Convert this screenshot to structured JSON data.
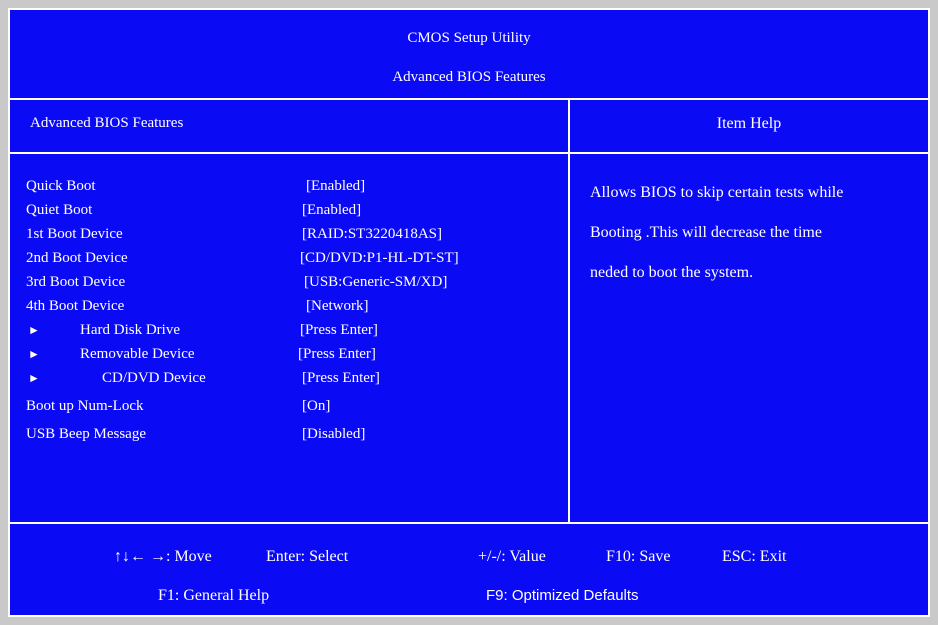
{
  "header": {
    "title": "CMOS Setup Utility",
    "subtitle": "Advanced BIOS Features"
  },
  "section": {
    "left_label": "Advanced BIOS Features",
    "right_label": "Item Help"
  },
  "settings": [
    {
      "label": "Quick Boot",
      "value": "[Enabled]",
      "submenu": false
    },
    {
      "label": "Quiet Boot",
      "value": "[Enabled]",
      "submenu": false
    },
    {
      "label": "1st Boot Device",
      "value": "[RAID:ST3220418AS]",
      "submenu": false
    },
    {
      "label": "2nd Boot Device",
      "value": "[CD/DVD:P1-HL-DT-ST]",
      "submenu": false
    },
    {
      "label": "3rd Boot Device",
      "value": "[USB:Generic-SM/XD]",
      "submenu": false
    },
    {
      "label": "4th Boot Device",
      "value": "[Network]",
      "submenu": false
    },
    {
      "label": "Hard Disk Drive",
      "value": "[Press Enter]",
      "submenu": true
    },
    {
      "label": "Removable Device",
      "value": "[Press Enter]",
      "submenu": true
    },
    {
      "label": "CD/DVD Device",
      "value": "[Press Enter]",
      "submenu": true
    },
    {
      "label": "Boot up Num-Lock",
      "value": "[On]",
      "submenu": false
    },
    {
      "label": "USB Beep Message",
      "value": "[Disabled]",
      "submenu": false
    }
  ],
  "help": {
    "lines": [
      "Allows BIOS to skip certain tests while",
      "Booting .This will decrease the time",
      "neded to boot the system."
    ]
  },
  "footer": {
    "move": "↑↓← →: Move",
    "select": "Enter: Select",
    "value": "+/-/: Value",
    "save": "F10: Save",
    "exit": "ESC: Exit",
    "general_help": "F1: General Help",
    "optimized_defaults": "F9: Optimized Defaults"
  },
  "icons": {
    "submenu_arrow": "submenu-arrow-icon"
  },
  "colors": {
    "background": "#0a0af5",
    "text": "#ffffff",
    "frame": "#c9c9c9"
  }
}
